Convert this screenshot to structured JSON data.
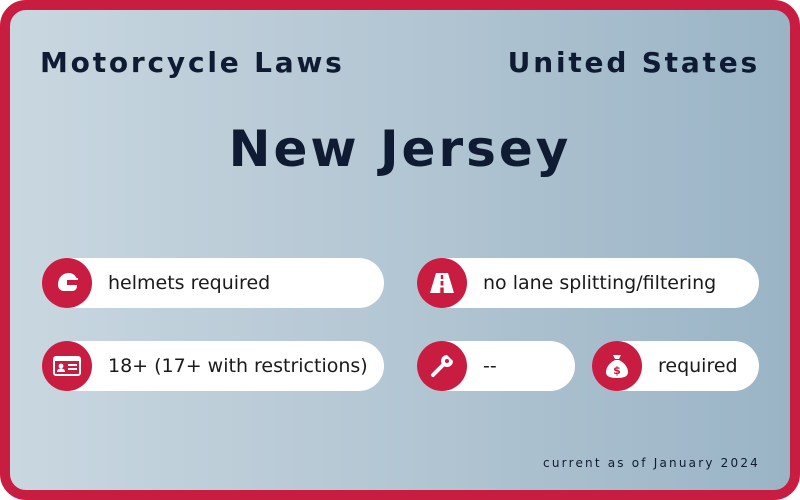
{
  "header": {
    "title": "Motorcycle Laws",
    "country": "United States"
  },
  "state": "New Jersey",
  "laws": {
    "helmet": {
      "icon": "helmet-icon",
      "text": "helmets required"
    },
    "lane_splitting": {
      "icon": "road-lanes-icon",
      "text": "no lane splitting/filtering"
    },
    "license_age": {
      "icon": "id-card-icon",
      "text": "18+ (17+ with restrictions)"
    },
    "inspection": {
      "icon": "wrench-icon",
      "text": "--"
    },
    "insurance": {
      "icon": "money-bag-icon",
      "text": "required"
    }
  },
  "footer": "current as of January 2024",
  "colors": {
    "accent": "#c81c40",
    "text_dark": "#0f1b33",
    "pill_bg": "#ffffff"
  }
}
